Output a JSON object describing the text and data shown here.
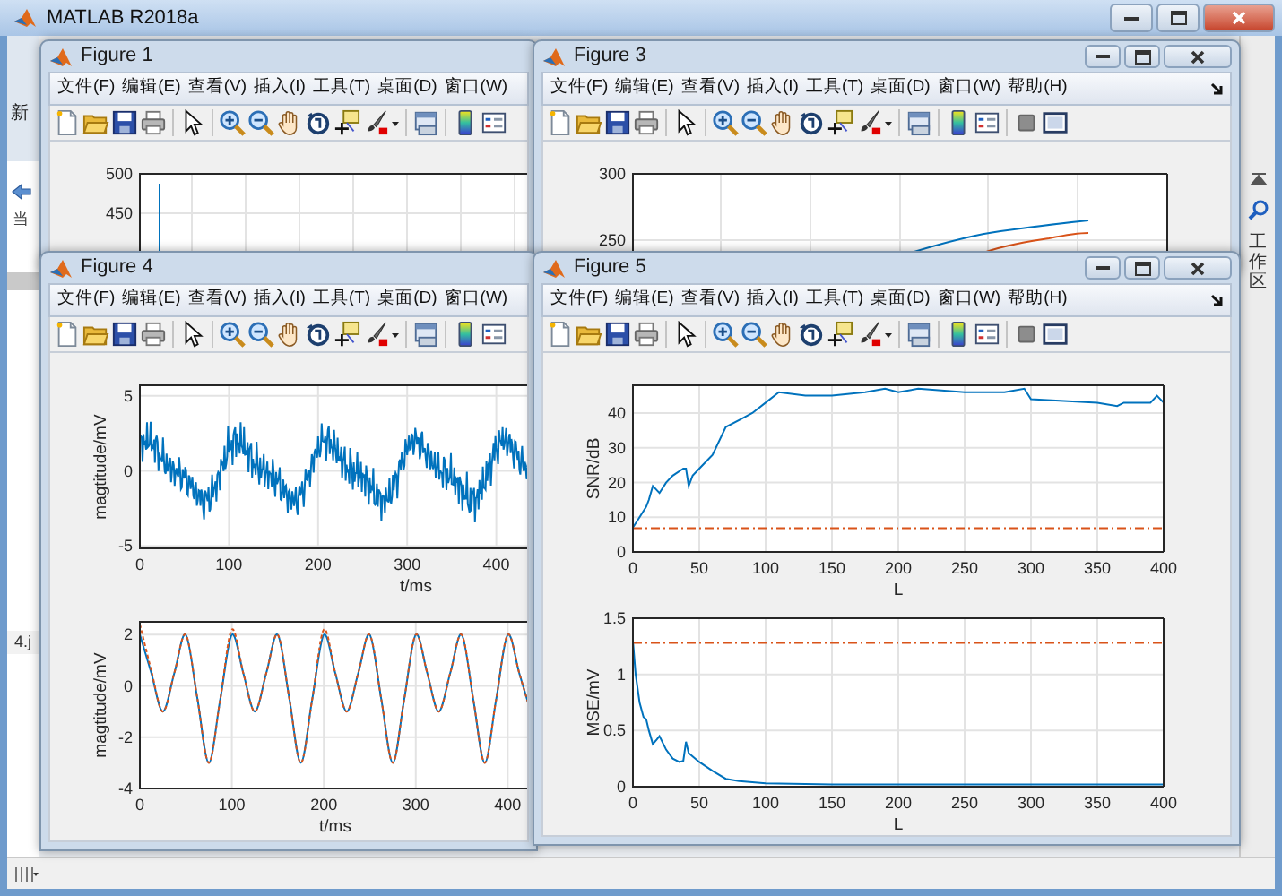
{
  "window": {
    "title": "MATLAB R2018a"
  },
  "left_panel": {
    "ribbon_label": "新",
    "folder_label": "当",
    "file_label": "4.j"
  },
  "right_panel": {
    "label": "工作区"
  },
  "figures": [
    {
      "title": "Figure 1",
      "menu": [
        "文件(F)",
        "编辑(E)",
        "查看(V)",
        "插入(I)",
        "工具(T)",
        "桌面(D)",
        "窗口(W)"
      ],
      "plot": {
        "yticks": [
          "500",
          "450"
        ]
      }
    },
    {
      "title": "Figure 3",
      "menu": [
        "文件(F)",
        "编辑(E)",
        "查看(V)",
        "插入(I)",
        "工具(T)",
        "桌面(D)",
        "窗口(W)",
        "帮助(H)"
      ],
      "plot": {
        "yticks": [
          "300",
          "250"
        ]
      }
    },
    {
      "title": "Figure 4",
      "menu": [
        "文件(F)",
        "编辑(E)",
        "查看(V)",
        "插入(I)",
        "工具(T)",
        "桌面(D)",
        "窗口(W)"
      ],
      "waveform": {
        "xlabel": "t/ms",
        "ylabel": "magtitude/mV",
        "xticks": [
          "0",
          "100",
          "200",
          "300",
          "400"
        ],
        "yticks": [
          "5",
          "0",
          "-5"
        ]
      },
      "chart_data": {
        "type": "line",
        "xlabel": "t/ms",
        "ylabel": "magtitude/mV",
        "grid": true,
        "x": [
          0,
          12.5,
          25,
          37.5,
          50,
          62.5,
          75,
          87.5,
          100,
          112.5,
          125,
          137.5,
          150,
          162.5,
          175,
          187.5,
          200,
          212.5,
          225,
          237.5,
          250,
          262.5,
          275,
          287.5,
          300,
          312.5,
          325,
          337.5,
          350,
          362.5,
          375,
          387.5,
          400,
          412.5,
          425
        ],
        "series": [
          {
            "color": "#0072bd",
            "line_style": "solid",
            "values": [
              2,
              0.5,
              -1,
              0.5,
              2,
              -0.5,
              -3,
              -0.5,
              2,
              0.5,
              -1,
              0.5,
              2,
              -0.5,
              -3,
              -0.5,
              2,
              0.5,
              -1,
              0.5,
              2,
              -0.5,
              -3,
              -0.5,
              2,
              0.5,
              -1,
              0.5,
              2,
              -0.5,
              -3,
              -0.5,
              2,
              0.5,
              -1
            ]
          },
          {
            "color": "#d95319",
            "line_style": "dashed",
            "values": [
              2.4,
              0.6,
              -1,
              0.5,
              2,
              -0.5,
              -3,
              -0.5,
              2.2,
              0.5,
              -1,
              0.5,
              2,
              -0.5,
              -3,
              -0.5,
              2.2,
              0.5,
              -1,
              0.5,
              2,
              -0.5,
              -3,
              -0.5,
              2,
              0.5,
              -1,
              0.5,
              2,
              -0.5,
              -3,
              -0.5,
              2,
              0.5,
              -1
            ]
          }
        ],
        "xlim": [
          0,
          425
        ],
        "ylim": [
          -4,
          2.5
        ],
        "xticks": [
          0,
          100,
          200,
          300,
          400
        ],
        "yticks": [
          -4,
          -2,
          0,
          2
        ]
      }
    },
    {
      "title": "Figure 5",
      "menu": [
        "文件(F)",
        "编辑(E)",
        "查看(V)",
        "插入(I)",
        "工具(T)",
        "桌面(D)",
        "窗口(W)",
        "帮助(H)"
      ],
      "charts": [
        {
          "chart_data": {
            "type": "line",
            "grid": true,
            "xlabel": "L",
            "ylabel": "SNR/dB",
            "x": [
              0,
              5,
              10,
              12,
              15,
              20,
              25,
              30,
              38,
              40,
              42,
              45,
              50,
              60,
              70,
              80,
              90,
              100,
              110,
              130,
              150,
              175,
              190,
              200,
              215,
              250,
              280,
              295,
              300,
              350,
              365,
              370,
              390,
              395,
              400
            ],
            "series": [
              {
                "color": "#0072bd",
                "line_style": "solid",
                "values": [
                  7,
                  10,
                  13,
                  15,
                  19,
                  17,
                  20,
                  22,
                  24,
                  24,
                  19,
                  22,
                  24,
                  28,
                  36,
                  38,
                  40,
                  43,
                  46,
                  45,
                  45,
                  46,
                  47,
                  46,
                  47,
                  46,
                  46,
                  47,
                  44,
                  43,
                  42,
                  43,
                  43,
                  45,
                  43
                ]
              },
              {
                "color": "#d95319",
                "line_style": "dash-dot",
                "values": [
                  6.8,
                  6.8,
                  6.8,
                  6.8,
                  6.8,
                  6.8,
                  6.8,
                  6.8,
                  6.8,
                  6.8,
                  6.8,
                  6.8,
                  6.8,
                  6.8,
                  6.8,
                  6.8,
                  6.8,
                  6.8,
                  6.8,
                  6.8,
                  6.8,
                  6.8,
                  6.8,
                  6.8,
                  6.8,
                  6.8,
                  6.8,
                  6.8,
                  6.8,
                  6.8,
                  6.8,
                  6.8,
                  6.8,
                  6.8,
                  6.8
                ]
              }
            ],
            "xlim": [
              0,
              400
            ],
            "ylim": [
              0,
              48
            ],
            "xticks": [
              0,
              50,
              100,
              150,
              200,
              250,
              300,
              350,
              400
            ],
            "yticks": [
              0,
              10,
              20,
              30,
              40
            ]
          }
        },
        {
          "chart_data": {
            "type": "line",
            "grid": true,
            "xlabel": "L",
            "ylabel": "MSE/mV",
            "x": [
              0,
              2,
              5,
              8,
              10,
              12,
              15,
              18,
              20,
              25,
              30,
              35,
              38,
              40,
              42,
              45,
              50,
              60,
              70,
              80,
              100,
              150,
              200,
              250,
              300,
              350,
              400
            ],
            "series": [
              {
                "color": "#0072bd",
                "line_style": "solid",
                "values": [
                  1.3,
                  1.0,
                  0.75,
                  0.62,
                  0.6,
                  0.5,
                  0.38,
                  0.42,
                  0.45,
                  0.33,
                  0.25,
                  0.22,
                  0.23,
                  0.4,
                  0.3,
                  0.27,
                  0.22,
                  0.14,
                  0.07,
                  0.05,
                  0.03,
                  0.02,
                  0.02,
                  0.02,
                  0.02,
                  0.02,
                  0.02
                ]
              },
              {
                "color": "#d95319",
                "line_style": "dash-dot",
                "values": [
                  1.28,
                  1.28,
                  1.28,
                  1.28,
                  1.28,
                  1.28,
                  1.28,
                  1.28,
                  1.28,
                  1.28,
                  1.28,
                  1.28,
                  1.28,
                  1.28,
                  1.28,
                  1.28,
                  1.28,
                  1.28,
                  1.28,
                  1.28,
                  1.28,
                  1.28,
                  1.28,
                  1.28,
                  1.28,
                  1.28,
                  1.28
                ]
              }
            ],
            "xlim": [
              0,
              400
            ],
            "ylim": [
              0,
              1.5
            ],
            "xticks": [
              0,
              50,
              100,
              150,
              200,
              250,
              300,
              350,
              400
            ],
            "yticks": [
              0,
              0.5,
              1,
              1.5
            ]
          }
        }
      ]
    }
  ]
}
